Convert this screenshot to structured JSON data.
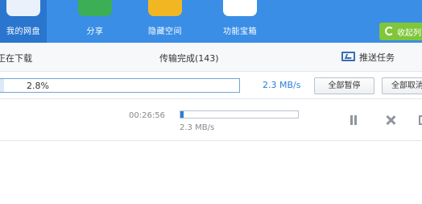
{
  "nav": {
    "items": [
      {
        "label": "我的网盘",
        "icon": "cloud-disk-icon",
        "color": "#ffffff"
      },
      {
        "label": "分享",
        "icon": "share-icon",
        "color": "#3cae55"
      },
      {
        "label": "隐藏空间",
        "icon": "lock-icon",
        "color": "#f3b623"
      },
      {
        "label": "功能宝箱",
        "icon": "search-tool-icon",
        "color": "#ffffff"
      }
    ],
    "collapse_label": "收起列",
    "collapse_icon": "collapse-icon"
  },
  "tabs": {
    "downloading": "正在下载",
    "complete": "传输完成(143)",
    "push_task": "推送任务",
    "push_icon": "monitor-icon"
  },
  "overall": {
    "percent_text": "2.8%",
    "progress": 0.028,
    "speed": "2.3 MB/s",
    "pause_all": "全部暂停",
    "cancel_all": "全部取消"
  },
  "task": {
    "remaining_time": "00:26:56",
    "progress": 0.028,
    "speed": "2.3 MB/s"
  },
  "colors": {
    "accent": "#3a8ee6",
    "speed_blue": "#2b7fd6",
    "collapse_green": "#7fc63a"
  }
}
